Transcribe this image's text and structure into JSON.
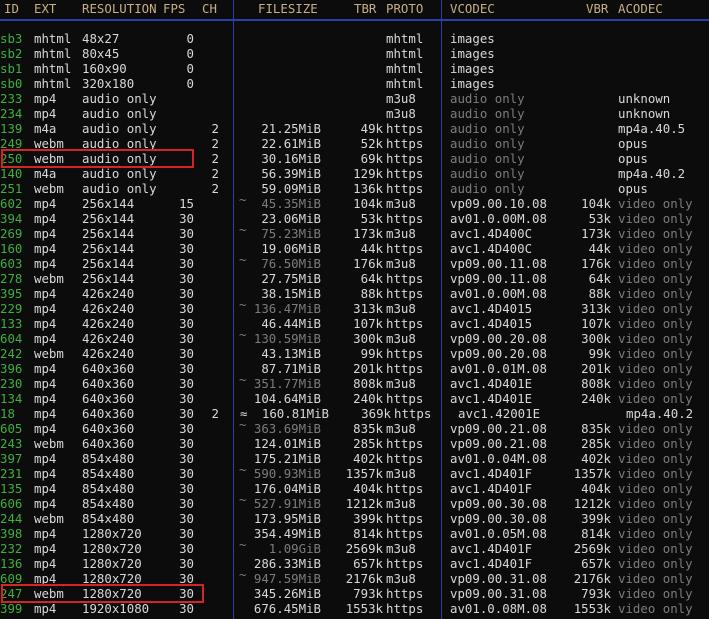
{
  "headers": {
    "id": "ID",
    "ext": "EXT",
    "resolution": "RESOLUTION",
    "fps": "FPS",
    "ch": "CH",
    "filesize": "FILESIZE",
    "tbr": "TBR",
    "proto": "PROTO",
    "vcodec": "VCODEC",
    "vbr": "VBR",
    "acodec": "ACODEC"
  },
  "colors": {
    "id": "#3fae3f",
    "header": "#c9ae86",
    "separator": "#2b3fa8",
    "highlight": "#d42424",
    "dim": "#7c7c7c",
    "text": "#d8d8d8"
  },
  "rows": [
    {
      "id": "sb3",
      "ext": "mhtml",
      "res": "48x27",
      "fps": "0",
      "ch": "",
      "approx": "",
      "size": "",
      "size_dim": false,
      "tbr": "",
      "proto": "mhtml",
      "vcodec": "images",
      "vcodec_dim": false,
      "vbr": "",
      "acodec": "",
      "acodec_dim": false
    },
    {
      "id": "sb2",
      "ext": "mhtml",
      "res": "80x45",
      "fps": "0",
      "ch": "",
      "approx": "",
      "size": "",
      "size_dim": false,
      "tbr": "",
      "proto": "mhtml",
      "vcodec": "images",
      "vcodec_dim": false,
      "vbr": "",
      "acodec": "",
      "acodec_dim": false
    },
    {
      "id": "sb1",
      "ext": "mhtml",
      "res": "160x90",
      "fps": "0",
      "ch": "",
      "approx": "",
      "size": "",
      "size_dim": false,
      "tbr": "",
      "proto": "mhtml",
      "vcodec": "images",
      "vcodec_dim": false,
      "vbr": "",
      "acodec": "",
      "acodec_dim": false
    },
    {
      "id": "sb0",
      "ext": "mhtml",
      "res": "320x180",
      "fps": "0",
      "ch": "",
      "approx": "",
      "size": "",
      "size_dim": false,
      "tbr": "",
      "proto": "mhtml",
      "vcodec": "images",
      "vcodec_dim": false,
      "vbr": "",
      "acodec": "",
      "acodec_dim": false
    },
    {
      "id": "233",
      "ext": "mp4",
      "res": "audio only",
      "fps": "",
      "ch": "",
      "approx": "",
      "size": "",
      "size_dim": false,
      "tbr": "",
      "proto": "m3u8",
      "vcodec": "audio only",
      "vcodec_dim": true,
      "vbr": "",
      "acodec": "unknown",
      "acodec_dim": false
    },
    {
      "id": "234",
      "ext": "mp4",
      "res": "audio only",
      "fps": "",
      "ch": "",
      "approx": "",
      "size": "",
      "size_dim": false,
      "tbr": "",
      "proto": "m3u8",
      "vcodec": "audio only",
      "vcodec_dim": true,
      "vbr": "",
      "acodec": "unknown",
      "acodec_dim": false
    },
    {
      "id": "139",
      "ext": "m4a",
      "res": "audio only",
      "fps": "",
      "ch": "2",
      "approx": "",
      "size": "21.25MiB",
      "size_dim": false,
      "tbr": "49k",
      "proto": "https",
      "vcodec": "audio only",
      "vcodec_dim": true,
      "vbr": "",
      "acodec": "mp4a.40.5",
      "acodec_dim": false
    },
    {
      "id": "249",
      "ext": "webm",
      "res": "audio only",
      "fps": "",
      "ch": "2",
      "approx": "",
      "size": "22.61MiB",
      "size_dim": false,
      "tbr": "52k",
      "proto": "https",
      "vcodec": "audio only",
      "vcodec_dim": true,
      "vbr": "",
      "acodec": "opus",
      "acodec_dim": false
    },
    {
      "id": "250",
      "ext": "webm",
      "res": "audio only",
      "fps": "",
      "ch": "2",
      "approx": "",
      "size": "30.16MiB",
      "size_dim": false,
      "tbr": "69k",
      "proto": "https",
      "vcodec": "audio only",
      "vcodec_dim": true,
      "vbr": "",
      "acodec": "opus",
      "acodec_dim": false,
      "highlighted": true
    },
    {
      "id": "140",
      "ext": "m4a",
      "res": "audio only",
      "fps": "",
      "ch": "2",
      "approx": "",
      "size": "56.39MiB",
      "size_dim": false,
      "tbr": "129k",
      "proto": "https",
      "vcodec": "audio only",
      "vcodec_dim": true,
      "vbr": "",
      "acodec": "mp4a.40.2",
      "acodec_dim": false
    },
    {
      "id": "251",
      "ext": "webm",
      "res": "audio only",
      "fps": "",
      "ch": "2",
      "approx": "",
      "size": "59.09MiB",
      "size_dim": false,
      "tbr": "136k",
      "proto": "https",
      "vcodec": "audio only",
      "vcodec_dim": true,
      "vbr": "",
      "acodec": "opus",
      "acodec_dim": false
    },
    {
      "id": "602",
      "ext": "mp4",
      "res": "256x144",
      "fps": "15",
      "ch": "",
      "approx": "~",
      "size": "45.35MiB",
      "size_dim": true,
      "tbr": "104k",
      "proto": "m3u8",
      "vcodec": "vp09.00.10.08",
      "vcodec_dim": false,
      "vbr": "104k",
      "acodec": "video only",
      "acodec_dim": true
    },
    {
      "id": "394",
      "ext": "mp4",
      "res": "256x144",
      "fps": "30",
      "ch": "",
      "approx": "",
      "size": "23.06MiB",
      "size_dim": false,
      "tbr": "53k",
      "proto": "https",
      "vcodec": "av01.0.00M.08",
      "vcodec_dim": false,
      "vbr": "53k",
      "acodec": "video only",
      "acodec_dim": true
    },
    {
      "id": "269",
      "ext": "mp4",
      "res": "256x144",
      "fps": "30",
      "ch": "",
      "approx": "~",
      "size": "75.23MiB",
      "size_dim": true,
      "tbr": "173k",
      "proto": "m3u8",
      "vcodec": "avc1.4D400C",
      "vcodec_dim": false,
      "vbr": "173k",
      "acodec": "video only",
      "acodec_dim": true
    },
    {
      "id": "160",
      "ext": "mp4",
      "res": "256x144",
      "fps": "30",
      "ch": "",
      "approx": "",
      "size": "19.06MiB",
      "size_dim": false,
      "tbr": "44k",
      "proto": "https",
      "vcodec": "avc1.4D400C",
      "vcodec_dim": false,
      "vbr": "44k",
      "acodec": "video only",
      "acodec_dim": true
    },
    {
      "id": "603",
      "ext": "mp4",
      "res": "256x144",
      "fps": "30",
      "ch": "",
      "approx": "~",
      "size": "76.50MiB",
      "size_dim": true,
      "tbr": "176k",
      "proto": "m3u8",
      "vcodec": "vp09.00.11.08",
      "vcodec_dim": false,
      "vbr": "176k",
      "acodec": "video only",
      "acodec_dim": true
    },
    {
      "id": "278",
      "ext": "webm",
      "res": "256x144",
      "fps": "30",
      "ch": "",
      "approx": "",
      "size": "27.75MiB",
      "size_dim": false,
      "tbr": "64k",
      "proto": "https",
      "vcodec": "vp09.00.11.08",
      "vcodec_dim": false,
      "vbr": "64k",
      "acodec": "video only",
      "acodec_dim": true
    },
    {
      "id": "395",
      "ext": "mp4",
      "res": "426x240",
      "fps": "30",
      "ch": "",
      "approx": "",
      "size": "38.15MiB",
      "size_dim": false,
      "tbr": "88k",
      "proto": "https",
      "vcodec": "av01.0.00M.08",
      "vcodec_dim": false,
      "vbr": "88k",
      "acodec": "video only",
      "acodec_dim": true
    },
    {
      "id": "229",
      "ext": "mp4",
      "res": "426x240",
      "fps": "30",
      "ch": "",
      "approx": "~",
      "size": "136.47MiB",
      "size_dim": true,
      "tbr": "313k",
      "proto": "m3u8",
      "vcodec": "avc1.4D4015",
      "vcodec_dim": false,
      "vbr": "313k",
      "acodec": "video only",
      "acodec_dim": true
    },
    {
      "id": "133",
      "ext": "mp4",
      "res": "426x240",
      "fps": "30",
      "ch": "",
      "approx": "",
      "size": "46.44MiB",
      "size_dim": false,
      "tbr": "107k",
      "proto": "https",
      "vcodec": "avc1.4D4015",
      "vcodec_dim": false,
      "vbr": "107k",
      "acodec": "video only",
      "acodec_dim": true
    },
    {
      "id": "604",
      "ext": "mp4",
      "res": "426x240",
      "fps": "30",
      "ch": "",
      "approx": "~",
      "size": "130.59MiB",
      "size_dim": true,
      "tbr": "300k",
      "proto": "m3u8",
      "vcodec": "vp09.00.20.08",
      "vcodec_dim": false,
      "vbr": "300k",
      "acodec": "video only",
      "acodec_dim": true
    },
    {
      "id": "242",
      "ext": "webm",
      "res": "426x240",
      "fps": "30",
      "ch": "",
      "approx": "",
      "size": "43.13MiB",
      "size_dim": false,
      "tbr": "99k",
      "proto": "https",
      "vcodec": "vp09.00.20.08",
      "vcodec_dim": false,
      "vbr": "99k",
      "acodec": "video only",
      "acodec_dim": true
    },
    {
      "id": "396",
      "ext": "mp4",
      "res": "640x360",
      "fps": "30",
      "ch": "",
      "approx": "",
      "size": "87.71MiB",
      "size_dim": false,
      "tbr": "201k",
      "proto": "https",
      "vcodec": "av01.0.01M.08",
      "vcodec_dim": false,
      "vbr": "201k",
      "acodec": "video only",
      "acodec_dim": true
    },
    {
      "id": "230",
      "ext": "mp4",
      "res": "640x360",
      "fps": "30",
      "ch": "",
      "approx": "~",
      "size": "351.77MiB",
      "size_dim": true,
      "tbr": "808k",
      "proto": "m3u8",
      "vcodec": "avc1.4D401E",
      "vcodec_dim": false,
      "vbr": "808k",
      "acodec": "video only",
      "acodec_dim": true
    },
    {
      "id": "134",
      "ext": "mp4",
      "res": "640x360",
      "fps": "30",
      "ch": "",
      "approx": "",
      "size": "104.64MiB",
      "size_dim": false,
      "tbr": "240k",
      "proto": "https",
      "vcodec": "avc1.4D401E",
      "vcodec_dim": false,
      "vbr": "240k",
      "acodec": "video only",
      "acodec_dim": true
    },
    {
      "id": "18",
      "ext": "mp4",
      "res": "640x360",
      "fps": "30",
      "ch": "2",
      "approx": "≈",
      "size": "160.81MiB",
      "size_dim": false,
      "tbr": "369k",
      "proto": "https",
      "vcodec": "avc1.42001E",
      "vcodec_dim": false,
      "vbr": "",
      "acodec": "mp4a.40.2",
      "acodec_dim": false,
      "shifted": true
    },
    {
      "id": "605",
      "ext": "mp4",
      "res": "640x360",
      "fps": "30",
      "ch": "",
      "approx": "~",
      "size": "363.69MiB",
      "size_dim": true,
      "tbr": "835k",
      "proto": "m3u8",
      "vcodec": "vp09.00.21.08",
      "vcodec_dim": false,
      "vbr": "835k",
      "acodec": "video only",
      "acodec_dim": true
    },
    {
      "id": "243",
      "ext": "webm",
      "res": "640x360",
      "fps": "30",
      "ch": "",
      "approx": "",
      "size": "124.01MiB",
      "size_dim": false,
      "tbr": "285k",
      "proto": "https",
      "vcodec": "vp09.00.21.08",
      "vcodec_dim": false,
      "vbr": "285k",
      "acodec": "video only",
      "acodec_dim": true
    },
    {
      "id": "397",
      "ext": "mp4",
      "res": "854x480",
      "fps": "30",
      "ch": "",
      "approx": "",
      "size": "175.21MiB",
      "size_dim": false,
      "tbr": "402k",
      "proto": "https",
      "vcodec": "av01.0.04M.08",
      "vcodec_dim": false,
      "vbr": "402k",
      "acodec": "video only",
      "acodec_dim": true
    },
    {
      "id": "231",
      "ext": "mp4",
      "res": "854x480",
      "fps": "30",
      "ch": "",
      "approx": "~",
      "size": "590.93MiB",
      "size_dim": true,
      "tbr": "1357k",
      "proto": "m3u8",
      "vcodec": "avc1.4D401F",
      "vcodec_dim": false,
      "vbr": "1357k",
      "acodec": "video only",
      "acodec_dim": true
    },
    {
      "id": "135",
      "ext": "mp4",
      "res": "854x480",
      "fps": "30",
      "ch": "",
      "approx": "",
      "size": "176.04MiB",
      "size_dim": false,
      "tbr": "404k",
      "proto": "https",
      "vcodec": "avc1.4D401F",
      "vcodec_dim": false,
      "vbr": "404k",
      "acodec": "video only",
      "acodec_dim": true
    },
    {
      "id": "606",
      "ext": "mp4",
      "res": "854x480",
      "fps": "30",
      "ch": "",
      "approx": "~",
      "size": "527.91MiB",
      "size_dim": true,
      "tbr": "1212k",
      "proto": "m3u8",
      "vcodec": "vp09.00.30.08",
      "vcodec_dim": false,
      "vbr": "1212k",
      "acodec": "video only",
      "acodec_dim": true
    },
    {
      "id": "244",
      "ext": "webm",
      "res": "854x480",
      "fps": "30",
      "ch": "",
      "approx": "",
      "size": "173.95MiB",
      "size_dim": false,
      "tbr": "399k",
      "proto": "https",
      "vcodec": "vp09.00.30.08",
      "vcodec_dim": false,
      "vbr": "399k",
      "acodec": "video only",
      "acodec_dim": true
    },
    {
      "id": "398",
      "ext": "mp4",
      "res": "1280x720",
      "fps": "30",
      "ch": "",
      "approx": "",
      "size": "354.49MiB",
      "size_dim": false,
      "tbr": "814k",
      "proto": "https",
      "vcodec": "av01.0.05M.08",
      "vcodec_dim": false,
      "vbr": "814k",
      "acodec": "video only",
      "acodec_dim": true
    },
    {
      "id": "232",
      "ext": "mp4",
      "res": "1280x720",
      "fps": "30",
      "ch": "",
      "approx": "~",
      "size": "1.09GiB",
      "size_dim": true,
      "tbr": "2569k",
      "proto": "m3u8",
      "vcodec": "avc1.4D401F",
      "vcodec_dim": false,
      "vbr": "2569k",
      "acodec": "video only",
      "acodec_dim": true
    },
    {
      "id": "136",
      "ext": "mp4",
      "res": "1280x720",
      "fps": "30",
      "ch": "",
      "approx": "",
      "size": "286.33MiB",
      "size_dim": false,
      "tbr": "657k",
      "proto": "https",
      "vcodec": "avc1.4D401F",
      "vcodec_dim": false,
      "vbr": "657k",
      "acodec": "video only",
      "acodec_dim": true
    },
    {
      "id": "609",
      "ext": "mp4",
      "res": "1280x720",
      "fps": "30",
      "ch": "",
      "approx": "~",
      "size": "947.59MiB",
      "size_dim": true,
      "tbr": "2176k",
      "proto": "m3u8",
      "vcodec": "vp09.00.31.08",
      "vcodec_dim": false,
      "vbr": "2176k",
      "acodec": "video only",
      "acodec_dim": true
    },
    {
      "id": "247",
      "ext": "webm",
      "res": "1280x720",
      "fps": "30",
      "ch": "",
      "approx": "",
      "size": "345.26MiB",
      "size_dim": false,
      "tbr": "793k",
      "proto": "https",
      "vcodec": "vp09.00.31.08",
      "vcodec_dim": false,
      "vbr": "793k",
      "acodec": "video only",
      "acodec_dim": true,
      "highlighted": true
    },
    {
      "id": "399",
      "ext": "mp4",
      "res": "1920x1080",
      "fps": "30",
      "ch": "",
      "approx": "",
      "size": "676.45MiB",
      "size_dim": false,
      "tbr": "1553k",
      "proto": "https",
      "vcodec": "av01.0.08M.08",
      "vcodec_dim": false,
      "vbr": "1553k",
      "acodec": "video only",
      "acodec_dim": true
    }
  ]
}
